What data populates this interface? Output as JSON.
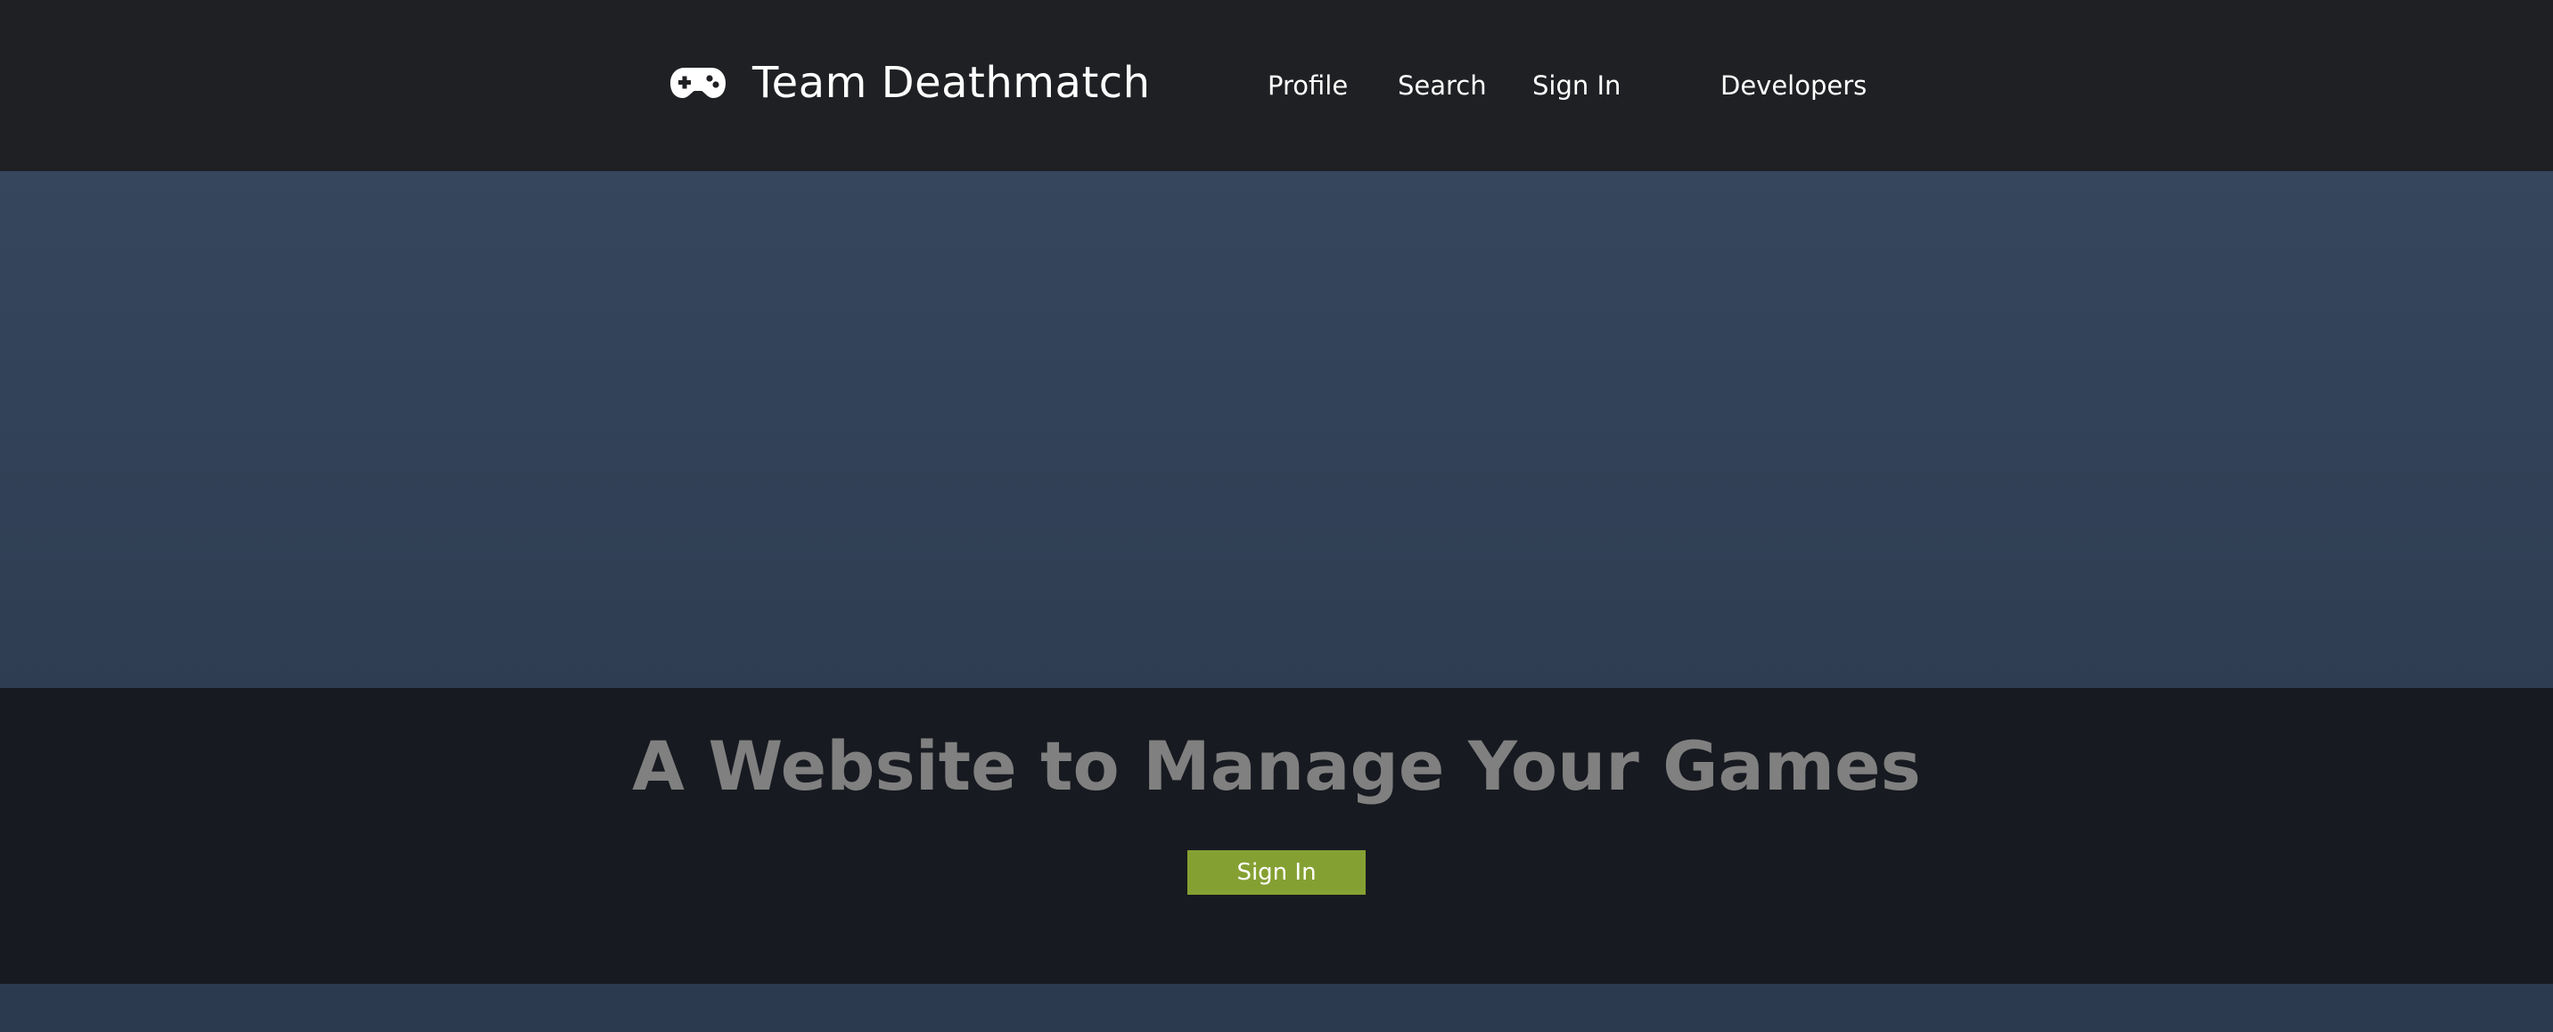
{
  "header": {
    "brand": {
      "icon": "gamepad-icon",
      "title": "Team Deathmatch"
    },
    "nav": {
      "profile": "Profile",
      "search": "Search",
      "sign_in": "Sign In",
      "developers": "Developers"
    }
  },
  "intro": {
    "tagline": "A Website to Manage Your Games",
    "cta_label": "Sign In"
  },
  "colors": {
    "header_bg": "#1f2023",
    "hero_bg": "#33445a",
    "intro_bg": "#181a21",
    "tagline_text": "#808080",
    "accent": "#85a032",
    "nav_text": "#ffffff"
  }
}
